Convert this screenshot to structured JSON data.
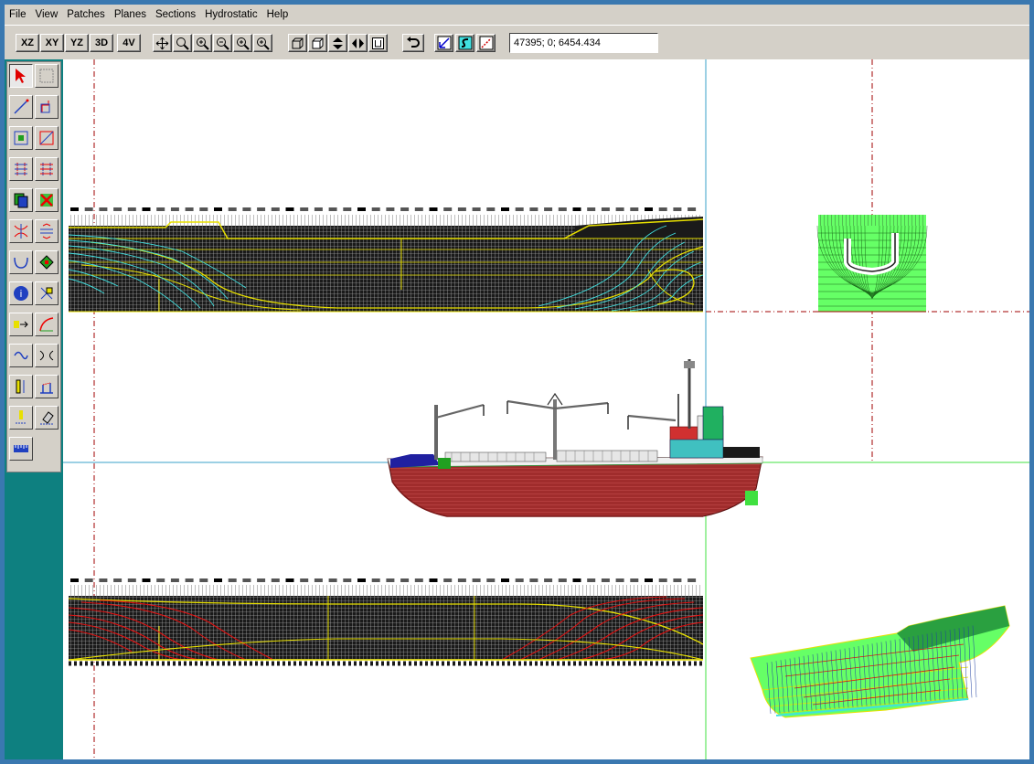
{
  "menu": {
    "items": [
      "File",
      "View",
      "Patches",
      "Planes",
      "Sections",
      "Hydrostatic",
      "Help"
    ]
  },
  "toolbar": {
    "view_buttons": [
      "XZ",
      "XY",
      "YZ",
      "3D",
      "4V"
    ],
    "coordinates": "47395; 0; 6454.434"
  },
  "icons": {
    "zoom_tools": [
      "pan-icon",
      "zoom-icon",
      "zoom-in-icon",
      "zoom-out-icon",
      "zoom-window-icon",
      "zoom-all-icon"
    ],
    "render_tools": [
      "wireframe-icon",
      "shaded-icon",
      "flip-vertical-icon",
      "flip-horizontal-icon",
      "section-box-icon"
    ],
    "misc_tools": [
      "undo-icon",
      "curve-tool-icon",
      "surface-tool-icon",
      "line-tool-icon"
    ],
    "left_tools": [
      "select-arrow-icon",
      "select-box-icon",
      "draw-line-icon",
      "draw-patch-icon",
      "edit-patch-icon",
      "trim-patch-icon",
      "move-points-icon",
      "scale-points-icon",
      "copy-patch-icon",
      "delete-patch-icon",
      "mirror-icon",
      "stretch-icon",
      "loft-icon",
      "rotate-icon",
      "info-icon",
      "cut-icon",
      "join-icon",
      "bend-icon",
      "offset-icon",
      "blend-icon",
      "height-tool-icon",
      "measure-tool-icon",
      "pin-tool-icon",
      "eraser-icon",
      "ruler-icon"
    ]
  },
  "colors": {
    "accent_frame": "#3a78b0",
    "teal_panel": "#0e8080",
    "hull_dark": "#111111",
    "station_yellow": "#e8e000",
    "station_cyan": "#40e0e0",
    "hull_red": "#a03030",
    "body_green": "#66ff66"
  }
}
